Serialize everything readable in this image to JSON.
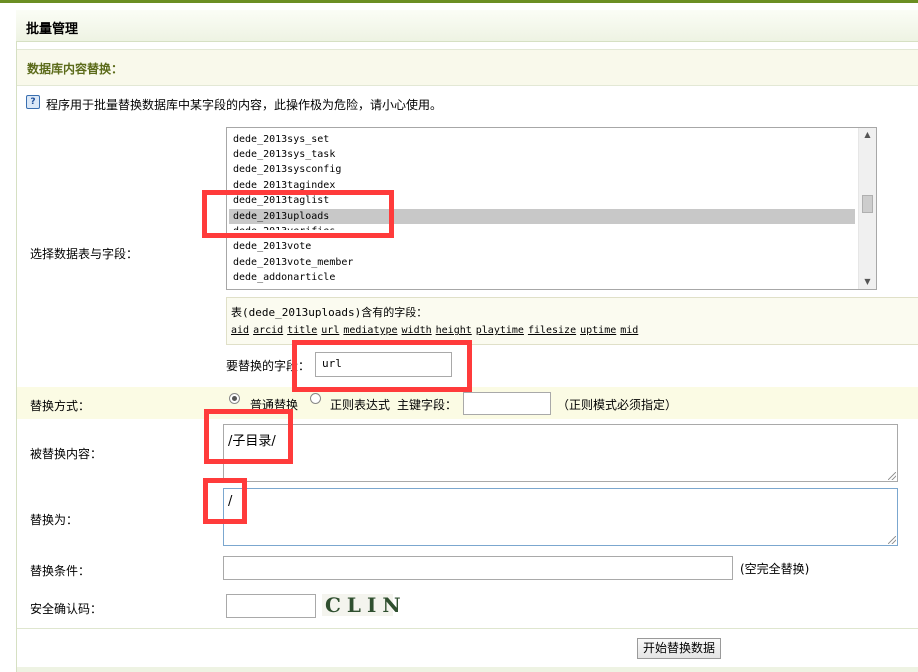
{
  "page": {
    "title": "批量管理"
  },
  "section": {
    "title": "数据库内容替换："
  },
  "info": {
    "icon": "help-icon",
    "text": "程序用于批量替换数据库中某字段的内容，此操作极为危险，请小心使用。"
  },
  "table_select": {
    "label": "选择数据表与字段：",
    "options": [
      "dede_2013sys_set",
      "dede_2013sys_task",
      "dede_2013sysconfig",
      "dede_2013tagindex",
      "dede_2013taglist",
      "dede_2013uploads",
      "dede_2013verifies",
      "dede_2013vote",
      "dede_2013vote_member",
      "dede_addonarticle"
    ],
    "selected": "dede_2013uploads"
  },
  "fields_panel": {
    "header": "表(dede_2013uploads)含有的字段：",
    "fields": [
      "aid",
      "arcid",
      "title",
      "url",
      "mediatype",
      "width",
      "height",
      "playtime",
      "filesize",
      "uptime",
      "mid"
    ]
  },
  "replace_field": {
    "label": "要替换的字段：",
    "value": "url"
  },
  "replace_mode": {
    "label": "替换方式：",
    "option_normal": "普通替换",
    "option_regex": "正则表达式",
    "primary_key_label": "主键字段：",
    "primary_key_value": "",
    "note": "（正则模式必须指定）",
    "selected": "普通替换"
  },
  "replaced_content": {
    "label": "被替换内容：",
    "value": "/子目录/"
  },
  "replace_with": {
    "label": "替换为：",
    "value": "/"
  },
  "condition": {
    "label": "替换条件：",
    "value": "",
    "note": "(空完全替换)"
  },
  "security_code": {
    "label": "安全确认码：",
    "value": "",
    "captcha_text": "CLIN"
  },
  "submit": {
    "label": "开始替换数据"
  },
  "colors": {
    "accent": "#6b8e23",
    "highlight": "#ff3b3b",
    "section_text": "#5c6b1a"
  }
}
